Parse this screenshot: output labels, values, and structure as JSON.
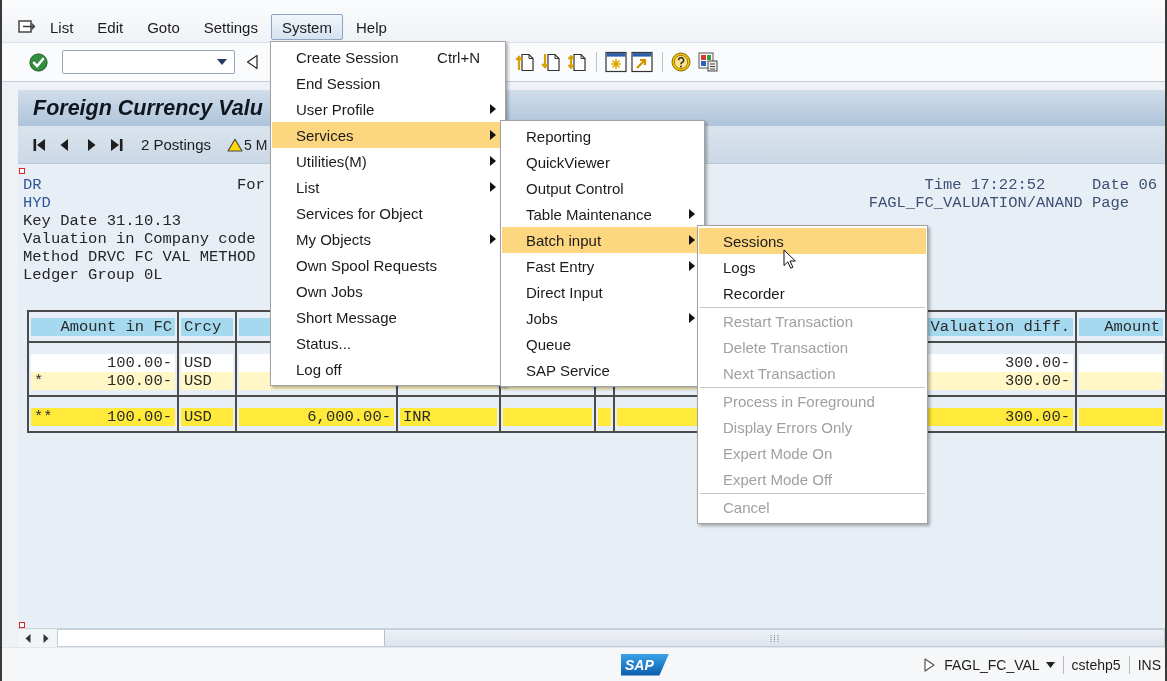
{
  "menu_bar": {
    "items": [
      {
        "label": "List",
        "selected": false
      },
      {
        "label": "Edit",
        "selected": false
      },
      {
        "label": "Goto",
        "selected": false
      },
      {
        "label": "Settings",
        "selected": false
      },
      {
        "label": "System",
        "selected": true
      },
      {
        "label": "Help",
        "selected": false
      }
    ]
  },
  "title": "Foreign Currency Valu",
  "app_toolbar": {
    "postings": "2 Postings",
    "messages": "5 M"
  },
  "report": {
    "lines": [
      {
        "kind": "accent",
        "text": "DR",
        "center": "For"
      },
      {
        "kind": "accent",
        "text": "HYD"
      },
      {
        "kind": "plain",
        "text": "Key Date 31.10.13"
      },
      {
        "kind": "plain",
        "text": "Valuation in Company code"
      },
      {
        "kind": "plain",
        "text": "Method DRVC FC VAL METHOD"
      },
      {
        "kind": "plain",
        "text": "Ledger Group 0L"
      }
    ],
    "time": "Time 17:22:52",
    "date": "Date 06",
    "program": "FAGL_FC_VALUATION/ANAND",
    "page": "Page"
  },
  "table": {
    "columns": [
      "Amount in FC",
      "Crcy",
      null,
      null,
      null,
      null,
      null,
      "Valuation diff.",
      "Amount"
    ],
    "groups": [
      {
        "rows": [
          {
            "kind": "line",
            "cells": [
              "100.00-",
              "USD",
              null,
              null,
              null,
              null,
              null,
              "300.00-",
              null
            ]
          },
          {
            "kind": "subtotal",
            "marker": "*",
            "cells": [
              "100.00-",
              "USD",
              null,
              null,
              null,
              null,
              null,
              "300.00-",
              null
            ]
          }
        ]
      },
      {
        "rows": [
          {
            "kind": "total",
            "marker": "**",
            "cells": [
              "100.00-",
              "USD",
              "6,000.00-",
              "INR",
              null,
              null,
              null,
              "300.00-",
              null
            ]
          }
        ]
      }
    ]
  },
  "status_bar": {
    "logo": "SAP",
    "transaction": "FAGL_FC_VAL",
    "server": "cstehp5",
    "mode": "INS"
  },
  "system_menu": {
    "groups": [
      {
        "items": [
          {
            "label": "Create Session",
            "shortcut": "Ctrl+N",
            "submenu": false,
            "selected": false
          },
          {
            "label": "End Session",
            "submenu": false,
            "selected": false
          },
          {
            "label": "User Profile",
            "submenu": true,
            "selected": false
          },
          {
            "label": "Services",
            "submenu": true,
            "selected": true
          },
          {
            "label": "Utilities(M)",
            "submenu": true,
            "selected": false
          },
          {
            "label": "List",
            "submenu": true,
            "selected": false
          },
          {
            "label": "Services for Object",
            "submenu": false,
            "selected": false
          },
          {
            "label": "My Objects",
            "submenu": true,
            "selected": false
          },
          {
            "label": "Own Spool Requests",
            "submenu": false,
            "selected": false
          },
          {
            "label": "Own Jobs",
            "submenu": false,
            "selected": false
          },
          {
            "label": "Short Message",
            "submenu": false,
            "selected": false
          },
          {
            "label": "Status...",
            "submenu": false,
            "selected": false
          },
          {
            "label": "Log off",
            "submenu": false,
            "selected": false
          }
        ]
      }
    ]
  },
  "services_menu": {
    "groups": [
      {
        "items": [
          {
            "label": "Reporting",
            "submenu": false,
            "selected": false
          },
          {
            "label": "QuickViewer",
            "submenu": false,
            "selected": false
          },
          {
            "label": "Output Control",
            "submenu": false,
            "selected": false
          },
          {
            "label": "Table Maintenance",
            "submenu": true,
            "selected": false
          },
          {
            "label": "Batch input",
            "submenu": true,
            "selected": true
          },
          {
            "label": "Fast Entry",
            "submenu": true,
            "selected": false
          },
          {
            "label": "Direct Input",
            "submenu": false,
            "selected": false
          },
          {
            "label": "Jobs",
            "submenu": true,
            "selected": false
          },
          {
            "label": "Queue",
            "submenu": false,
            "selected": false
          },
          {
            "label": "SAP Service",
            "submenu": false,
            "selected": false
          }
        ]
      }
    ]
  },
  "batch_input_menu": {
    "groups": [
      {
        "items": [
          {
            "label": "Sessions",
            "selected": true,
            "disabled": false
          },
          {
            "label": "Logs",
            "selected": false,
            "disabled": false
          },
          {
            "label": "Recorder",
            "selected": false,
            "disabled": false
          }
        ]
      },
      {
        "items": [
          {
            "label": "Restart Transaction",
            "selected": false,
            "disabled": true
          },
          {
            "label": "Delete Transaction",
            "selected": false,
            "disabled": true
          },
          {
            "label": "Next Transaction",
            "selected": false,
            "disabled": true
          }
        ]
      },
      {
        "items": [
          {
            "label": "Process in Foreground",
            "selected": false,
            "disabled": true
          },
          {
            "label": "Display Errors Only",
            "selected": false,
            "disabled": true
          },
          {
            "label": "Expert Mode On",
            "selected": false,
            "disabled": true
          },
          {
            "label": "Expert Mode Off",
            "selected": false,
            "disabled": true
          }
        ]
      },
      {
        "items": [
          {
            "label": "Cancel",
            "selected": false,
            "disabled": true
          }
        ]
      }
    ]
  }
}
